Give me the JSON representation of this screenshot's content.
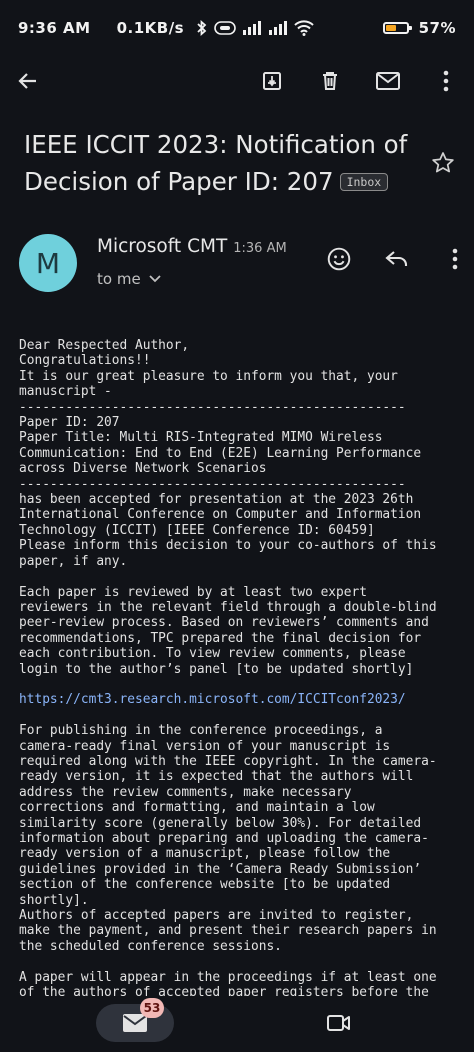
{
  "status_bar": {
    "time": "9:36 AM",
    "network_speed": "0.1KB/s",
    "battery_percent": "57%",
    "battery_level": 0.57,
    "battery_color": "#f5a623"
  },
  "toolbar": {
    "icons": [
      "back-arrow-icon",
      "archive-icon",
      "delete-icon",
      "mark-unread-icon",
      "more-vert-icon"
    ]
  },
  "email": {
    "subject": "IEEE ICCIT 2023: Notification of Decision of Paper ID: 207",
    "label": "Inbox",
    "sender": {
      "initial": "M",
      "name": "Microsoft CMT",
      "time": "1:36 AM",
      "recipient": "to me",
      "avatar_color": "#6fd0dc"
    },
    "body_before_link": "Dear Respected Author,\nCongratulations!!\nIt is our great pleasure to inform you that, your\nmanuscript -\n--------------------------------------------------\nPaper ID: 207\nPaper Title: Multi RIS-Integrated MIMO Wireless\nCommunication: End to End (E2E) Learning Performance\nacross Diverse Network Scenarios\n--------------------------------------------------\nhas been accepted for presentation at the 2023 26th\nInternational Conference on Computer and Information\nTechnology (ICCIT) [IEEE Conference ID: 60459]\nPlease inform this decision to your co-authors of this\npaper, if any.\n\nEach paper is reviewed by at least two expert\nreviewers in the relevant field through a double-blind\npeer-review process. Based on reviewers’ comments and\nrecommendations, TPC prepared the final decision for\neach contribution. To view review comments, please\nlogin to the author’s panel [to be updated shortly]\n\n",
    "link": "https://cmt3.research.microsoft.com/ICCITconf2023/",
    "body_after_link": "\n\nFor publishing in the conference proceedings, a\ncamera-ready final version of your manuscript is\nrequired along with the IEEE copyright. In the camera-\nready version, it is expected that the authors will\naddress the review comments, make necessary\ncorrections and formatting, and maintain a low\nsimilarity score (generally below 30%). For detailed\ninformation about preparing and uploading the camera-\nready version of a manuscript, please follow the\nguidelines provided in the ‘Camera Ready Submission’\nsection of the conference website [to be updated\nshortly].\nAuthors of accepted papers are invited to register,\nmake the payment, and present their research papers in\nthe scheduled conference sessions.\n\nA paper will appear in the proceedings if at least one\nof the authors of accepted paper registers before the"
  },
  "bottom_nav": {
    "mail_badge": "53"
  }
}
